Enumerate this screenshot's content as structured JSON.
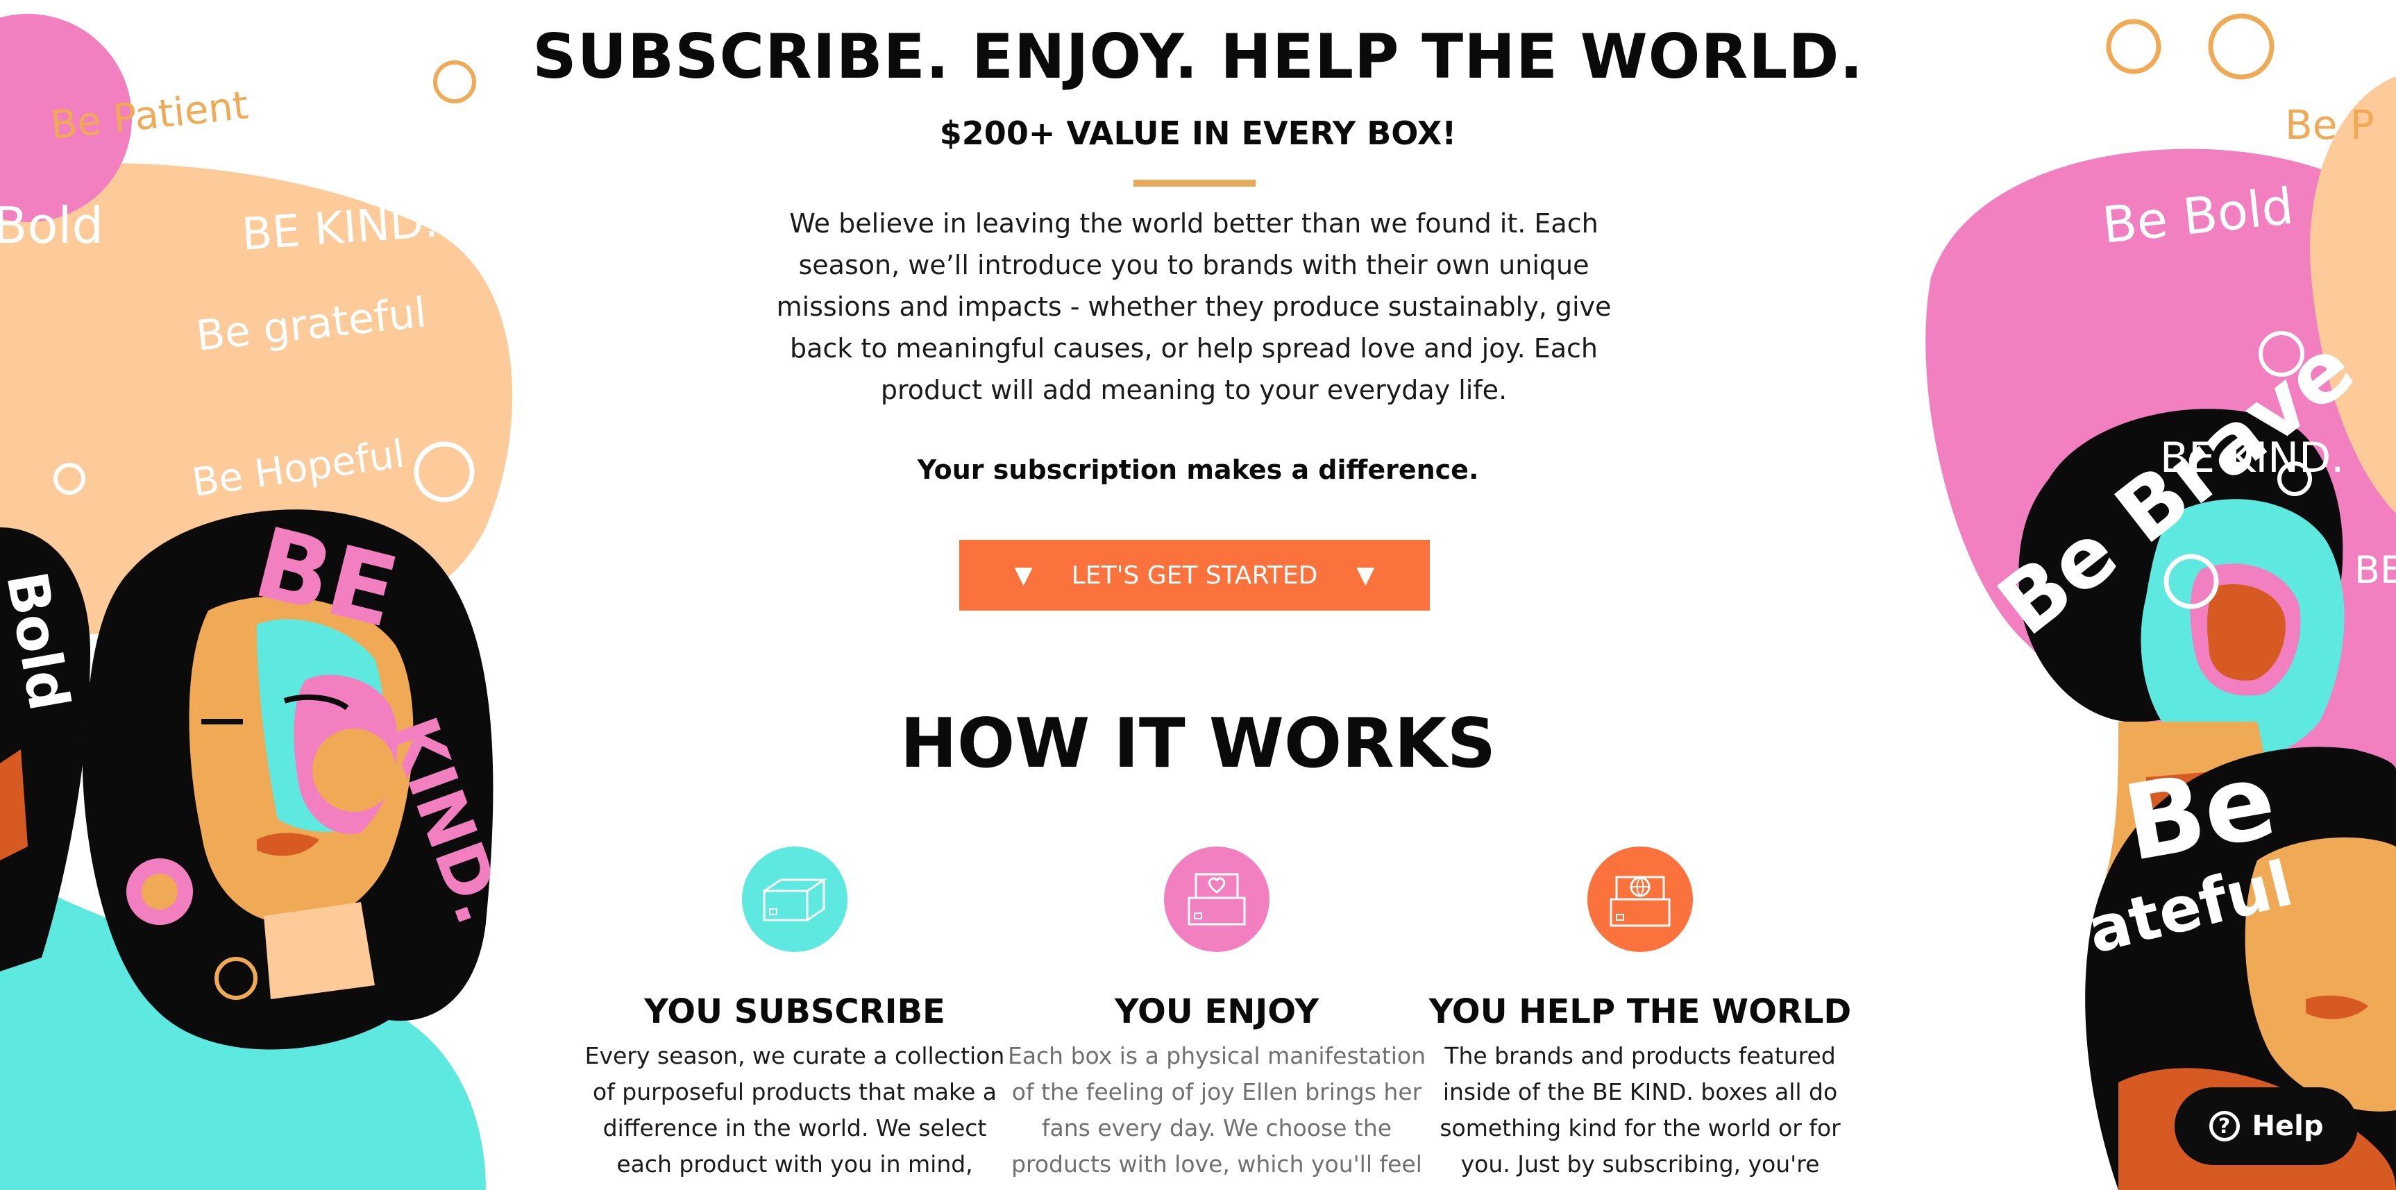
{
  "hero": {
    "headline": "SUBSCRIBE. ENJOY. HELP THE WORLD.",
    "subheadline": "$200+ VALUE IN EVERY BOX!",
    "intro_lines": [
      "We believe in leaving the world better than we found it. Each",
      "season, we’ll introduce you to brands with their own unique",
      "missions and impacts - whether they produce sustainably, give",
      "back to meaningful causes, or help spread love and joy. Each",
      "product will add meaning to your everyday life."
    ],
    "tagline": "Your subscription makes a difference.",
    "cta_label": "LET'S GET STARTED",
    "cta_arrow": "▼"
  },
  "how_it_works": {
    "title": "HOW IT WORKS",
    "steps": [
      {
        "title": "YOU SUBSCRIBE",
        "icon": "box-icon",
        "color": "#5ee9e0",
        "lines": [
          "Every season, we curate a collection",
          "of purposeful products that make a",
          "difference in the world. We select",
          "each product with you in mind,"
        ]
      },
      {
        "title": "YOU ENJOY",
        "icon": "heart-box-icon",
        "color": "#f27fc0",
        "lines": [
          "Each box is a physical manifestation",
          "of the feeling of joy Ellen brings her",
          "fans every day. We choose the",
          "products with love, which you'll feel"
        ]
      },
      {
        "title": "YOU HELP THE WORLD",
        "icon": "globe-box-icon",
        "color": "#fb723c",
        "lines": [
          "The brands and products featured",
          "inside of the BE KIND. boxes all do",
          "something kind for the world or for",
          "you. Just by subscribing, you're"
        ]
      }
    ]
  },
  "art": {
    "left_texts": [
      "Be Patient",
      "Bold",
      "BE KIND.",
      "Be grateful",
      "Be Hopeful",
      "BE",
      "KIND.",
      "Bold"
    ],
    "right_texts": [
      "Be Bold",
      "BE KIND.",
      "Be Brave",
      "Be",
      "grateful",
      "BE",
      "Be P"
    ]
  },
  "help": {
    "label": "Help",
    "icon_glyph": "?"
  },
  "colors": {
    "accent_orange": "#fb723c",
    "divider_gold": "#e8a95a",
    "pink": "#f27fc0",
    "peach": "#fccb99",
    "turquoise": "#5ee9e0",
    "rust": "#d85a23"
  }
}
